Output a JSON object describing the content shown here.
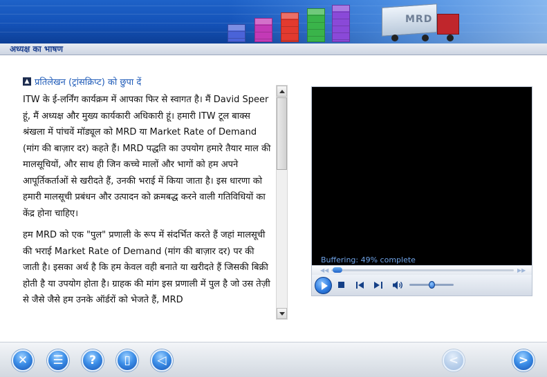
{
  "header": {
    "section_title": "अध्यक्ष का भाषण",
    "banner_truck_label": "MRD",
    "banner_cube_colors": [
      "#4a63d8",
      "#c33ab6",
      "#e23a2f",
      "#3ab44a",
      "#8a49d8"
    ]
  },
  "transcript": {
    "toggle_icon": "collapse-icon",
    "toggle_label": "प्रतिलेखन (ट्रांसक्रिप्ट) को छुपा दें",
    "paragraphs": [
      "ITW के ई-लर्निंग कार्यक्रम में आपका फिर से स्वागत है। मैं David Speer हूं, मैं अध्यक्ष और मुख्य कार्यकारी अधिकारी हूं। हमारी ITW टूल बाक्स श्रंखला में पांचवें मॉड्यूल को MRD या Market Rate of Demand (मांग की बाज़ार दर) कहते हैं। MRD पद्धति का उपयोग हमारे तैयार माल की मालसूचियों, और साथ ही जिन कच्चे मालों और भागों को हम अपने आपूर्तिकर्ताओं से खरीदते हैं, उनकी भराई में किया जाता है। इस धारणा को हमारी मालसूची प्रबंधन और उत्पादन को क्रमबद्ध करने वाली गतिविधियों का केंद्र होना चाहिए।",
      "हम MRD को एक \"पुल\" प्रणाली के रूप में संदर्भित करते हैं जहां मालसूची की भराई Market Rate of Demand (मांग की बाज़ार दर) पर की जाती है। इसका अर्थ है कि हम केवल वही बनाते या खरीदते हैं जिसकी बिक्री होती है या उपयोग होता है। ग्राहक की मांग इस प्रणाली में पुल है जो उस तेज़ी से जैसे जैसे हम उनके ऑर्डरों को भेजते हैं, MRD"
    ]
  },
  "player": {
    "status": "Buffering: 49% complete",
    "buffer_progress": 0.49,
    "volume_level": 0.45,
    "icons": {
      "play": "play-icon",
      "stop": "stop-icon",
      "previous": "previous-track-icon",
      "next": "next-track-icon",
      "volume": "speaker-icon"
    }
  },
  "footer": {
    "buttons": [
      {
        "name": "exit-button",
        "icon": "close-icon",
        "glyph": "✕"
      },
      {
        "name": "menu-button",
        "icon": "tree-menu-icon",
        "glyph": "☰"
      },
      {
        "name": "help-button",
        "icon": "question-icon",
        "glyph": "?"
      },
      {
        "name": "transcript-button",
        "icon": "film-strip-icon",
        "glyph": "▯"
      },
      {
        "name": "audio-button",
        "icon": "speaker-icon",
        "glyph": "◁"
      }
    ],
    "back_glyph": "<",
    "next_glyph": ">",
    "colors": {
      "accent": "#1f62c8",
      "disabled": "#bcd2ec"
    }
  }
}
